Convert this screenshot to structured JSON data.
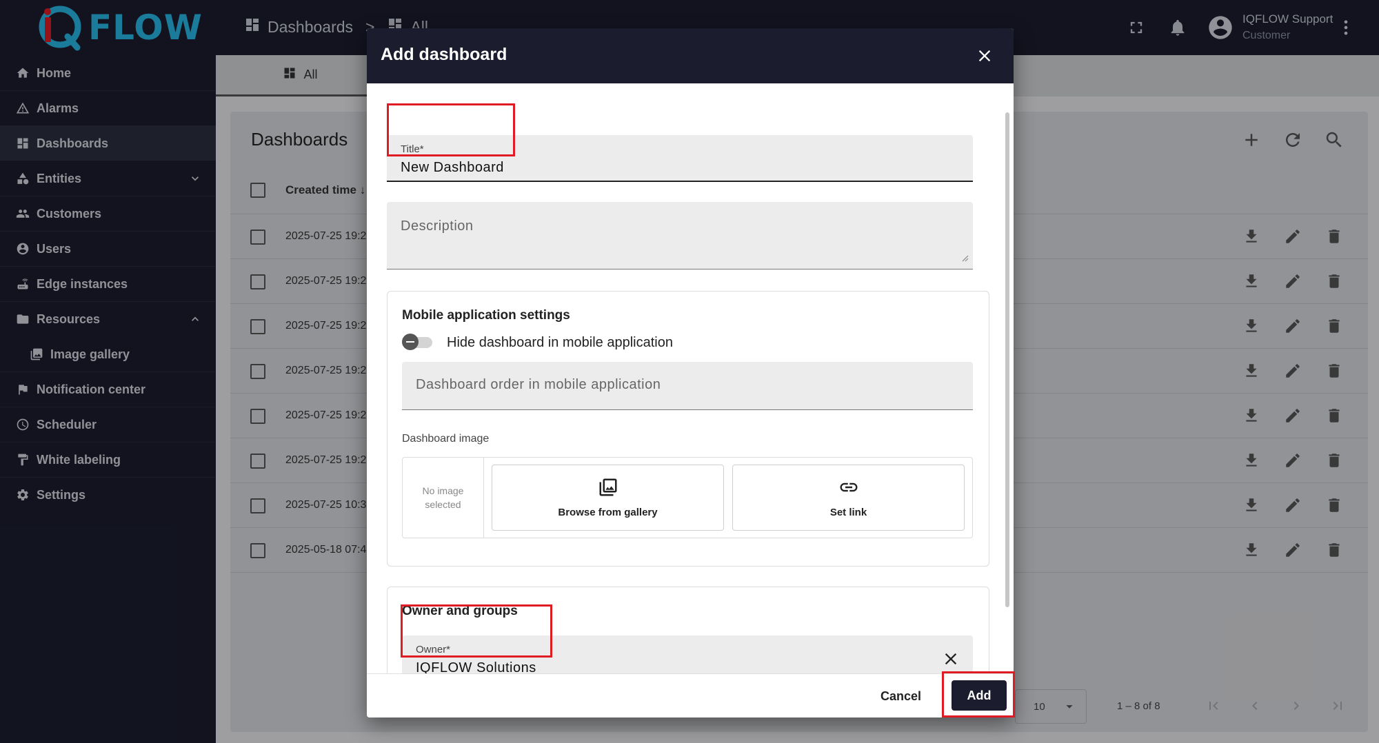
{
  "app": {
    "logo_text": "FLOW",
    "breadcrumb": [
      "Dashboards",
      ">",
      "All"
    ],
    "user_name": "IQFLOW Support",
    "user_role": "Customer"
  },
  "sidebar": {
    "items": [
      {
        "label": "Home",
        "icon": "home-icon"
      },
      {
        "label": "Alarms",
        "icon": "warning-icon"
      },
      {
        "label": "Dashboards",
        "icon": "dashboard-icon",
        "active": true
      },
      {
        "label": "Entities",
        "icon": "entities-icon",
        "expandable": "down"
      },
      {
        "label": "Customers",
        "icon": "people-icon"
      },
      {
        "label": "Users",
        "icon": "account-icon"
      },
      {
        "label": "Edge instances",
        "icon": "router-icon"
      },
      {
        "label": "Resources",
        "icon": "folder-icon",
        "expandable": "up"
      },
      {
        "label": "Image gallery",
        "icon": "image-icon",
        "sub": true
      },
      {
        "label": "Notification center",
        "icon": "flag-icon"
      },
      {
        "label": "Scheduler",
        "icon": "clock-icon"
      },
      {
        "label": "White labeling",
        "icon": "paint-roller-icon"
      },
      {
        "label": "Settings",
        "icon": "gear-icon"
      }
    ]
  },
  "main": {
    "tab_all": "All",
    "card_title": "Dashboards",
    "column_created": "Created time",
    "rows": [
      "2025-07-25 19:2",
      "2025-07-25 19:2",
      "2025-07-25 19:2",
      "2025-07-25 19:2",
      "2025-07-25 19:2",
      "2025-07-25 19:2",
      "2025-07-25 10:3",
      "2025-05-18 07:4"
    ],
    "page_size": "10",
    "page_range": "1 – 8 of 8"
  },
  "dialog": {
    "title": "Add dashboard",
    "title_field_label": "Title*",
    "title_field_value": "New Dashboard",
    "description_placeholder": "Description",
    "mobile_section_title": "Mobile application settings",
    "hide_toggle_label": "Hide dashboard in mobile application",
    "order_placeholder": "Dashboard order in mobile application",
    "image_label": "Dashboard image",
    "no_image_line1": "No image",
    "no_image_line2": "selected",
    "browse_label": "Browse from gallery",
    "set_link_label": "Set link",
    "owner_section_title": "Owner and groups",
    "owner_label": "Owner*",
    "owner_value": "IQFLOW Solutions",
    "cancel_label": "Cancel",
    "add_label": "Add"
  },
  "colors": {
    "nav_bg": "#1b1d2e",
    "brand_blue": "#29b6e3",
    "brand_red": "#e01b24",
    "highlight": "#e01b24"
  }
}
